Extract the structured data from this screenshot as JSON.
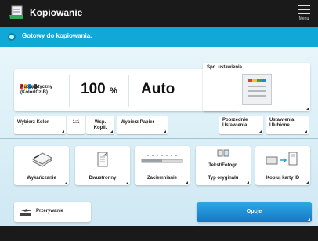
{
  "title": "Kopiowanie",
  "menu_label": "Menu",
  "status": "Gotowy do kopiowania.",
  "info": {
    "color_mode": "Automatyczny (Kolor/Cz-B)",
    "zoom_value": "100",
    "zoom_unit": "%",
    "paper": "Auto",
    "copies": "1"
  },
  "special_settings": "Spc. ustawienia",
  "buttons": {
    "select_color": "Wybierz Kolor",
    "ratio": "1:1",
    "magnify": "Wsp. Kopii.",
    "select_paper": "Wybierz Papier",
    "previous_settings": "Poprzednie Ustawienia",
    "favorites": "Ustawienia Ulubione"
  },
  "functions": [
    {
      "label": "Wykańczanie"
    },
    {
      "label": "Dwustronny"
    },
    {
      "label": "Zaciemnianie"
    },
    {
      "label": "Typ oryginału",
      "sub": "Tekst/Fotogr."
    },
    {
      "label": "Kopiuj karty ID"
    }
  ],
  "interrupt": "Przerywanie",
  "options": "Opcje"
}
